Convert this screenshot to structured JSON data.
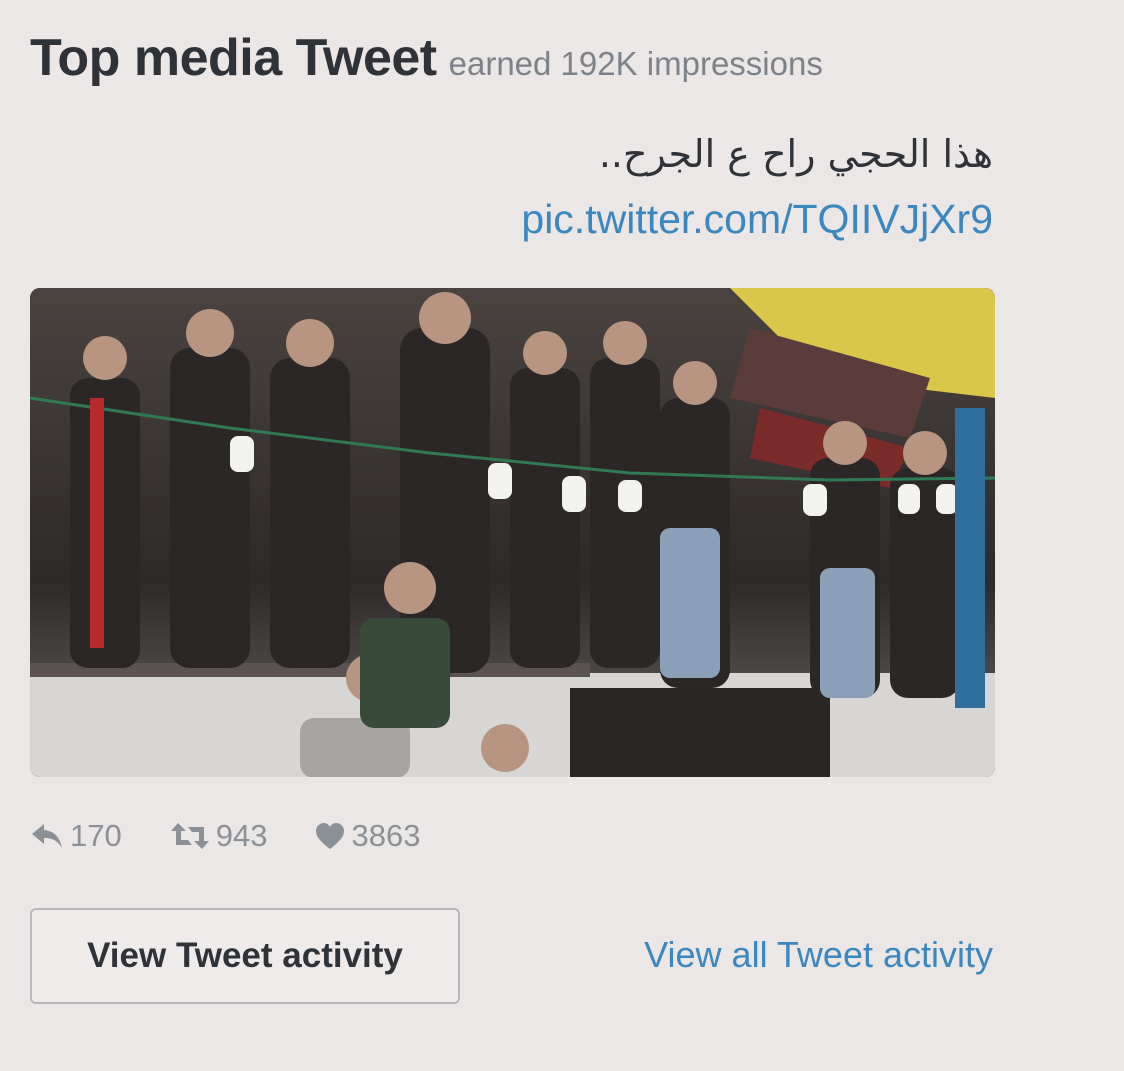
{
  "header": {
    "title": "Top media Tweet",
    "subtitle": "earned 192K impressions"
  },
  "tweet": {
    "text": "هذا الحجي راح ع الجرح..",
    "link": "pic.twitter.com/TQIIVJjXr9",
    "media_description_icon": "video-thumbnail"
  },
  "stats": {
    "replies": "170",
    "retweets": "943",
    "likes": "3863"
  },
  "buttons": {
    "view_activity": "View Tweet activity",
    "view_all": "View all Tweet activity"
  },
  "colors": {
    "link": "#3b87c0",
    "background": "#ebe7e6",
    "icon": "#8c9197"
  }
}
